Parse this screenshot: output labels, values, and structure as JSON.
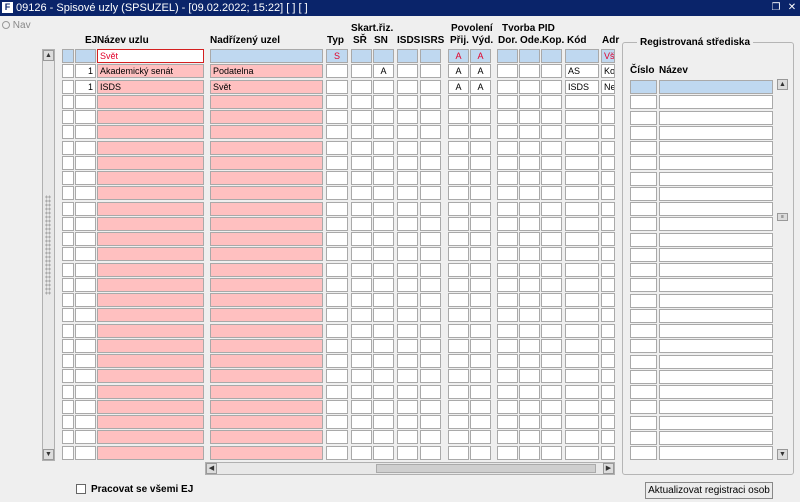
{
  "window": {
    "title": "09126 - Spisové uzly (SPSUZEL) - [09.02.2022; 15:22] [ ] [ ]",
    "app_icon": "oracle-forms-icon",
    "restore_icon": "restore-icon",
    "close_icon": "close-icon"
  },
  "nav": {
    "label": "Nav"
  },
  "grid": {
    "headers": {
      "ej": "EJ",
      "nazev_uzlu": "Název uzlu",
      "nadrizeny_uzel": "Nadřízený uzel",
      "typ": "Typ",
      "skart_group": "Skart.řiz.",
      "sr": "SŘ",
      "sn": "SN",
      "isds": "ISDS",
      "isrs": "ISRS",
      "povoleni_group": "Povolení",
      "prij": "Přij.",
      "vyd": "Výd.",
      "tvorba_group": "Tvorba PID",
      "dor": "Dor.",
      "ode": "Ode.",
      "kop": "Kop.",
      "kod": "Kód",
      "adr": "Adr"
    },
    "query_row": {
      "nazev_uzlu": "Svět",
      "typ": "S",
      "prij": "A",
      "vyd": "A",
      "adr": "Vš"
    },
    "rows": [
      {
        "ej": "1",
        "nazev": "Akademický senát",
        "nadrizeny": "Podatelna",
        "typ": "",
        "sr": "",
        "sn": "A",
        "isds": "",
        "isrs": "",
        "prij": "A",
        "vyd": "A",
        "dor": "",
        "ode": "",
        "kop": "",
        "kod": "AS",
        "adr": "Ko"
      },
      {
        "ej": "1",
        "nazev": "ISDS",
        "nadrizeny": "Svět",
        "typ": "",
        "sr": "",
        "sn": "",
        "isds": "",
        "isrs": "",
        "prij": "A",
        "vyd": "A",
        "dor": "",
        "ode": "",
        "kop": "",
        "kod": "ISDS",
        "adr": "Ne"
      }
    ]
  },
  "registry": {
    "title": "Registrovaná střediska",
    "col_cislo": "Číslo",
    "col_nazev": "Název"
  },
  "footer": {
    "checkbox_label": "Pracovat se všemi EJ",
    "update_button": "Aktualizovat registraci osob"
  },
  "colors": {
    "titlebar": "#0a246a",
    "required_field": "#ffc0c0",
    "query_row": "#bfd8f0",
    "query_text": "#e0002a"
  }
}
